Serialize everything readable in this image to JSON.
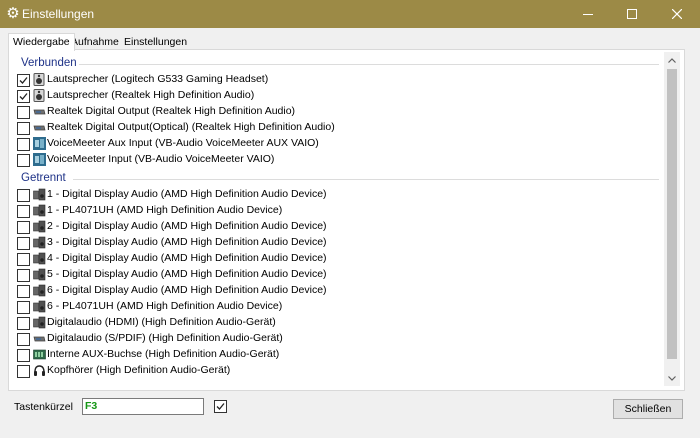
{
  "window": {
    "title": "Einstellungen",
    "app_icon": "gear-icon",
    "controls": [
      "minimize-icon",
      "maximize-icon",
      "close-icon"
    ],
    "title_bar_color": "#9c8a46"
  },
  "tabs": [
    {
      "label": "Wiedergabe",
      "active": true
    },
    {
      "label": "Aufnahme",
      "active": false
    },
    {
      "label": "Einstellungen",
      "active": false
    }
  ],
  "groups": {
    "connected": {
      "label": "Verbunden",
      "items": [
        {
          "label": "Lautsprecher (Logitech G533 Gaming Headset)",
          "checked": true,
          "icon": "speaker-icon"
        },
        {
          "label": "Lautsprecher (Realtek High Definition Audio)",
          "checked": true,
          "icon": "speaker-icon"
        },
        {
          "label": "Realtek Digital Output (Realtek High Definition Audio)",
          "checked": false,
          "icon": "digital-output-icon"
        },
        {
          "label": "Realtek Digital Output(Optical) (Realtek High Definition Audio)",
          "checked": false,
          "icon": "digital-output-icon"
        },
        {
          "label": "VoiceMeeter Aux Input (VB-Audio VoiceMeeter AUX VAIO)",
          "checked": false,
          "icon": "voicemeeter-icon"
        },
        {
          "label": "VoiceMeeter Input (VB-Audio VoiceMeeter VAIO)",
          "checked": false,
          "icon": "voicemeeter-icon"
        }
      ]
    },
    "disconnected": {
      "label": "Getrennt",
      "items": [
        {
          "label": "1 - Digital Display Audio (AMD High Definition Audio Device)",
          "checked": false,
          "icon": "display-speaker-icon"
        },
        {
          "label": "1 - PL4071UH (AMD High Definition Audio Device)",
          "checked": false,
          "icon": "display-speaker-icon"
        },
        {
          "label": "2 - Digital Display Audio (AMD High Definition Audio Device)",
          "checked": false,
          "icon": "display-speaker-icon"
        },
        {
          "label": "3 - Digital Display Audio (AMD High Definition Audio Device)",
          "checked": false,
          "icon": "display-speaker-icon"
        },
        {
          "label": "4 - Digital Display Audio (AMD High Definition Audio Device)",
          "checked": false,
          "icon": "display-speaker-icon"
        },
        {
          "label": "5 - Digital Display Audio (AMD High Definition Audio Device)",
          "checked": false,
          "icon": "display-speaker-icon"
        },
        {
          "label": "6 - Digital Display Audio (AMD High Definition Audio Device)",
          "checked": false,
          "icon": "display-speaker-icon"
        },
        {
          "label": "6 - PL4071UH (AMD High Definition Audio Device)",
          "checked": false,
          "icon": "display-speaker-icon"
        },
        {
          "label": "Digitalaudio (HDMI) (High Definition Audio-Gerät)",
          "checked": false,
          "icon": "display-speaker-icon"
        },
        {
          "label": "Digitalaudio (S/PDIF) (High Definition Audio-Gerät)",
          "checked": false,
          "icon": "digital-output-icon"
        },
        {
          "label": "Interne AUX-Buchse (High Definition Audio-Gerät)",
          "checked": false,
          "icon": "aux-jack-icon"
        },
        {
          "label": "Kopfhörer (High Definition Audio-Gerät)",
          "checked": false,
          "icon": "headphones-icon"
        }
      ]
    }
  },
  "footer": {
    "shortcut_label": "Tastenkürzel",
    "shortcut_value": "F3",
    "shortcut_enabled": true,
    "close_button": "Schließen"
  }
}
